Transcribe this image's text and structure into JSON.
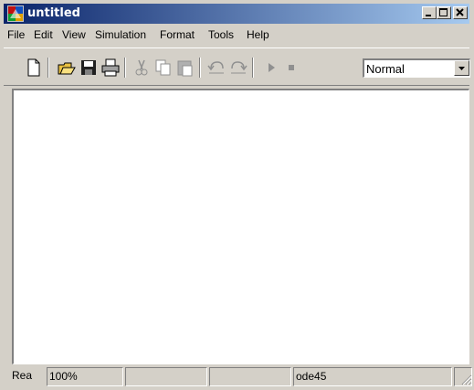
{
  "window": {
    "title": "untitled"
  },
  "menubar": {
    "items": [
      "File",
      "Edit",
      "View",
      "Simulation",
      "Format",
      "Tools",
      "Help"
    ]
  },
  "toolbar": {
    "buttons": [
      "new-model",
      "open",
      "save",
      "print",
      "cut",
      "copy",
      "paste",
      "undo",
      "redo",
      "start-simulation",
      "stop-simulation"
    ],
    "simulation_mode": {
      "value": "Normal"
    }
  },
  "statusbar": {
    "status": "Rea",
    "zoom": "100%",
    "field3": "",
    "field4": "",
    "solver": "ode45",
    "field6": ""
  },
  "colors": {
    "title_start": "#0a246a",
    "title_end": "#a6caf0",
    "face": "#d4d0c8"
  }
}
